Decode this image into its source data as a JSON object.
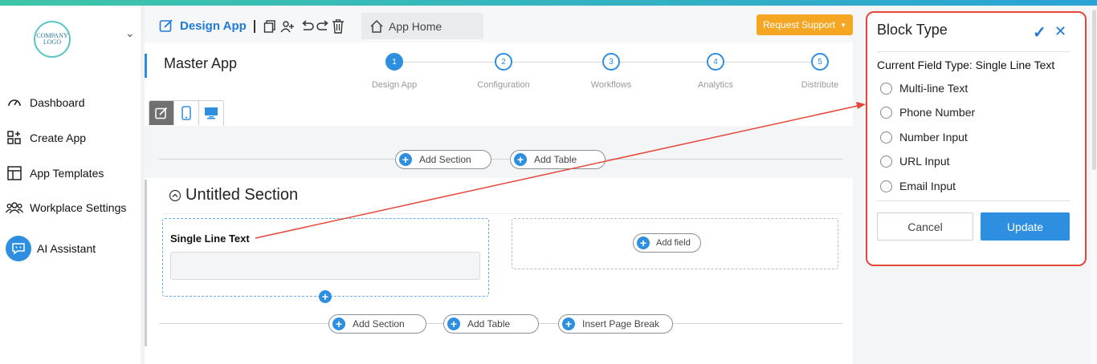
{
  "brand": {
    "logo_text": "COMPANY LOGO",
    "accent": "#2e8fe0",
    "highlight": "#e5463a",
    "support": "#f5a623"
  },
  "sidebar": {
    "items": [
      {
        "label": "Dashboard",
        "icon": "gauge-icon"
      },
      {
        "label": "Create App",
        "icon": "grid-plus-icon"
      },
      {
        "label": "App Templates",
        "icon": "layout-icon"
      },
      {
        "label": "Workplace Settings",
        "icon": "users-icon"
      },
      {
        "label": "AI Assistant",
        "icon": "ai-chat-icon"
      }
    ]
  },
  "toolbar": {
    "design_tab": "Design App",
    "app_home": "App Home",
    "request_support": "Request Support"
  },
  "app": {
    "title": "Master App"
  },
  "steps": [
    {
      "num": "1",
      "label": "Design App",
      "active": true
    },
    {
      "num": "2",
      "label": "Configuration",
      "active": false
    },
    {
      "num": "3",
      "label": "Workflows",
      "active": false
    },
    {
      "num": "4",
      "label": "Analytics",
      "active": false
    },
    {
      "num": "5",
      "label": "Distribute",
      "active": false
    }
  ],
  "canvas": {
    "top_add_section": "Add Section",
    "top_add_table": "Add Table",
    "section_title": "Untitled Section",
    "field_label": "Single Line Text",
    "add_field": "Add field",
    "bottom_add_section": "Add Section",
    "bottom_add_table": "Add Table",
    "insert_page_break": "Insert Page Break"
  },
  "block_type_panel": {
    "title": "Block Type",
    "current_label": "Current Field Type: Single Line Text",
    "options": [
      "Multi-line Text",
      "Phone Number",
      "Number Input",
      "URL Input",
      "Email Input"
    ],
    "cancel": "Cancel",
    "update": "Update"
  }
}
